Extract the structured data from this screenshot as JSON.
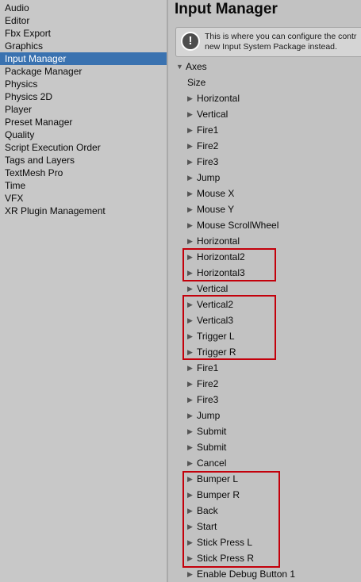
{
  "sidebar": {
    "items": [
      {
        "label": "Audio",
        "selected": false
      },
      {
        "label": "Editor",
        "selected": false
      },
      {
        "label": "Fbx Export",
        "selected": false
      },
      {
        "label": "Graphics",
        "selected": false
      },
      {
        "label": "Input Manager",
        "selected": true
      },
      {
        "label": "Package Manager",
        "selected": false
      },
      {
        "label": "Physics",
        "selected": false
      },
      {
        "label": "Physics 2D",
        "selected": false
      },
      {
        "label": "Player",
        "selected": false
      },
      {
        "label": "Preset Manager",
        "selected": false
      },
      {
        "label": "Quality",
        "selected": false
      },
      {
        "label": "Script Execution Order",
        "selected": false
      },
      {
        "label": "Tags and Layers",
        "selected": false
      },
      {
        "label": "TextMesh Pro",
        "selected": false
      },
      {
        "label": "Time",
        "selected": false
      },
      {
        "label": "VFX",
        "selected": false
      },
      {
        "label": "XR Plugin Management",
        "selected": false
      }
    ]
  },
  "main": {
    "title": "Input Manager",
    "help": {
      "icon": "warning-icon",
      "line1": "This is where you can configure the contr",
      "line2": "new Input System Package instead."
    },
    "axes_label": "Axes",
    "size_label": "Size",
    "axes": [
      "Horizontal",
      "Vertical",
      "Fire1",
      "Fire2",
      "Fire3",
      "Jump",
      "Mouse X",
      "Mouse Y",
      "Mouse ScrollWheel",
      "Horizontal",
      "Horizontal2",
      "Horizontal3",
      "Vertical",
      "Vertical2",
      "Vertical3",
      "Trigger L",
      "Trigger R",
      "Fire1",
      "Fire2",
      "Fire3",
      "Jump",
      "Submit",
      "Submit",
      "Cancel",
      "Bumper L",
      "Bumper R",
      "Back",
      "Start",
      "Stick Press L",
      "Stick Press R",
      "Enable Debug Button 1"
    ]
  },
  "colors": {
    "selection": "#3a72b0",
    "highlight_box": "#c3000b",
    "panel_bg": "#c2c2c2"
  }
}
